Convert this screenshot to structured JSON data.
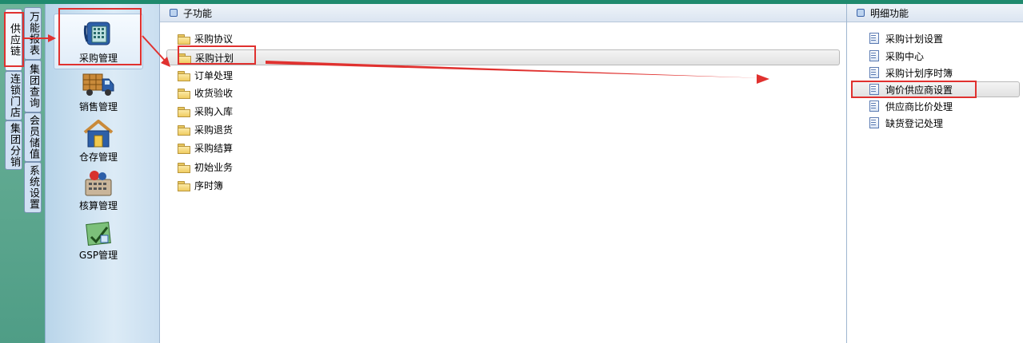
{
  "side_tabs": {
    "col1": [
      {
        "label": "供应链",
        "active": true
      },
      {
        "label": "连锁门店",
        "active": false
      },
      {
        "label": "集团分销",
        "active": false
      }
    ],
    "col2": [
      {
        "label": "万能报表"
      },
      {
        "label": "集团查询"
      },
      {
        "label": "会员储值"
      },
      {
        "label": "系统设置"
      }
    ]
  },
  "modules": [
    {
      "label": "采购管理",
      "icon": "purchase-phone-icon"
    },
    {
      "label": "销售管理",
      "icon": "delivery-truck-icon"
    },
    {
      "label": "仓存管理",
      "icon": "warehouse-house-icon"
    },
    {
      "label": "核算管理",
      "icon": "calculator-icon"
    },
    {
      "label": "GSP管理",
      "icon": "gsp-certificate-icon"
    }
  ],
  "sub_panel": {
    "title": "子功能",
    "items": [
      "采购协议",
      "采购计划",
      "订单处理",
      "收货验收",
      "采购入库",
      "采购退货",
      "采购结算",
      "初始业务",
      "序时簿"
    ],
    "selected_index": 1
  },
  "detail_panel": {
    "title": "明细功能",
    "items": [
      "采购计划设置",
      "采购中心",
      "采购计划序时簿",
      "询价供应商设置",
      "供应商比价处理",
      "缺货登记处理"
    ],
    "selected_index": 3
  },
  "colors": {
    "annotation_red": "#e0312f",
    "header_green": "#1f8a6e"
  }
}
